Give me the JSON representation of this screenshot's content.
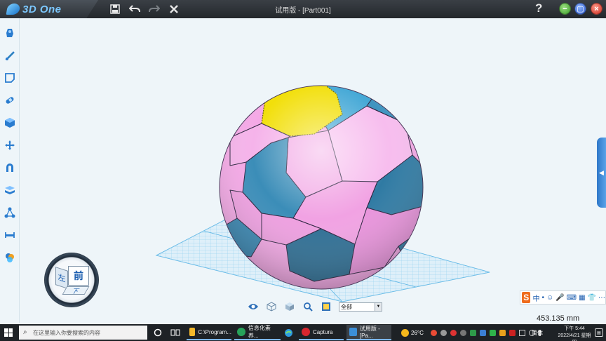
{
  "app": {
    "logo_text": "3D One",
    "window_title": "试用版 - [Part001]",
    "help_glyph": "?"
  },
  "colors": {
    "titlebar": "#2d3237",
    "accent": "#2e77c9",
    "ball_pink": "#f4a8e6",
    "ball_blue": "#3e8fb8",
    "selected_face": "#f2df0a",
    "grid": "#6cc0ec"
  },
  "titlebar_icons": [
    "save-icon",
    "undo-icon",
    "redo-icon",
    "close-x-icon"
  ],
  "left_tools": [
    "basic-solid-icon",
    "sketch-icon",
    "sketch-edit-icon",
    "special-feature-icon",
    "feature-modify-icon",
    "transform-icon",
    "combine-icon",
    "pattern-icon",
    "group-icon",
    "measure-icon",
    "color-render-icon"
  ],
  "navcube": {
    "front": "前",
    "left": "左",
    "bottom": "下"
  },
  "viewbar": {
    "icons": [
      "eye-icon",
      "wireframe-cube-icon",
      "shaded-cube-icon",
      "zoom-icon",
      "filter-icon"
    ],
    "filter_value": "全部"
  },
  "measurement": "453.135 mm",
  "ime": {
    "logo": "S",
    "lang": "中",
    "items": [
      "•",
      "☺",
      "🎤",
      "⌨",
      "▦",
      "👕",
      "⋯"
    ]
  },
  "taskbar": {
    "search_placeholder": "在这里输入你要搜索的内容",
    "tasks": [
      {
        "label": "C:\\Program...",
        "icon_color": "#f3b82b"
      },
      {
        "label": "信息化素养...",
        "icon_color": "#27a35a"
      },
      {
        "label": "Captura",
        "icon_color": "#d7262e"
      },
      {
        "label": "试用版 - [Pa...",
        "icon_color": "#3c8fd8"
      }
    ],
    "weather": "26°C",
    "ime_lang": "简体",
    "time": "下午 5:44",
    "date": "2022/4/21 星期四"
  }
}
